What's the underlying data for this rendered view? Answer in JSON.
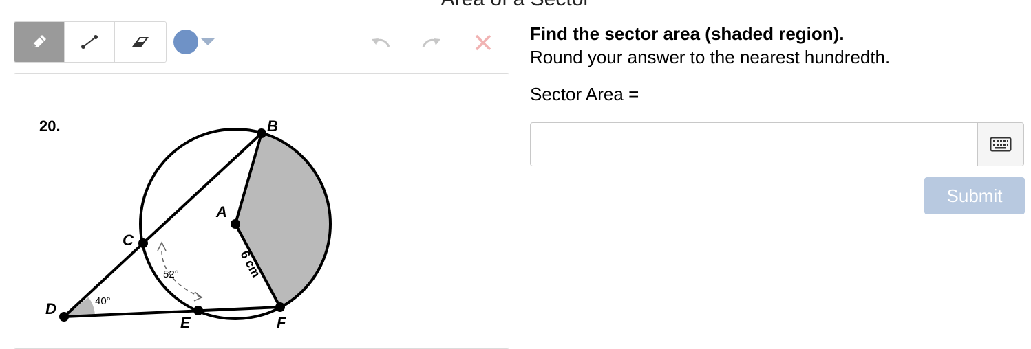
{
  "page": {
    "title": "Area of a Sector"
  },
  "toolbar": {
    "tools": [
      "pencil",
      "line",
      "eraser"
    ],
    "active_tool": "pencil",
    "selected_color": "#6f92c6",
    "icons": {
      "pencil": "pencil-icon",
      "line": "line-segment-icon",
      "eraser": "eraser-icon",
      "undo": "undo-icon",
      "redo": "redo-icon",
      "clear": "close-icon",
      "keyboard": "keyboard-icon"
    }
  },
  "figure": {
    "problem_number": "20.",
    "points": {
      "A": "A",
      "B": "B",
      "C": "C",
      "D": "D",
      "E": "E",
      "F": "F"
    },
    "radius_label": "6 cm",
    "arc_label": "52°",
    "angle_label": "40°"
  },
  "problem": {
    "instruction_bold": "Find the sector area (shaded region).",
    "instruction": "Round your answer to the nearest hundredth.",
    "answer_label": "Sector Area =",
    "answer_value": "",
    "submit_label": "Submit"
  },
  "colors": {
    "shaded_region": "#bababa",
    "submit_disabled": "#b8c9e0",
    "clear_icon": "#f1b3b3",
    "undo_redo_disabled": "#c7c7c7"
  }
}
